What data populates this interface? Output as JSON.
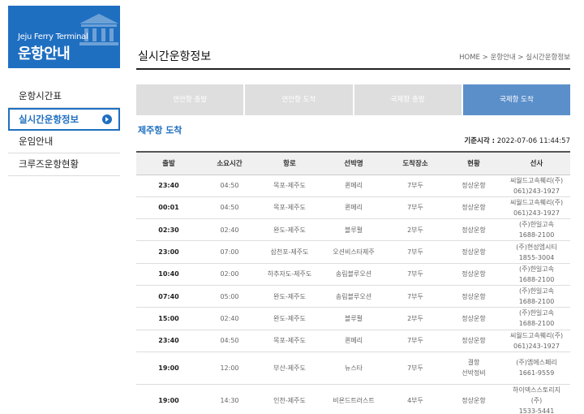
{
  "logo": {
    "en": "Jeju Ferry Terminal",
    "ko": "운항안내",
    "icon": "building-icon"
  },
  "sidebar": {
    "items": [
      {
        "label": "운항시간표"
      },
      {
        "label": "실시간운항정보"
      },
      {
        "label": "운임안내"
      },
      {
        "label": "크루즈운항현황"
      }
    ]
  },
  "header": {
    "title": "실시간운항정보",
    "breadcrumb": "HOME > 운항안내 > 실시간운항정보"
  },
  "tabs": [
    {
      "label": "연안항 출발"
    },
    {
      "label": "연안항 도착"
    },
    {
      "label": "국제항 출발"
    },
    {
      "label": "국제항 도착"
    }
  ],
  "section": {
    "title": "제주항 도착",
    "base_time_label": "기준시각 :",
    "base_time_value": "2022-07-06 11:44:57"
  },
  "table": {
    "headers": [
      "출발",
      "소요시간",
      "항로",
      "선박명",
      "도착장소",
      "현황",
      "선사"
    ],
    "rows": [
      {
        "dep": "23:40",
        "dur": "04:50",
        "route": "목포-제주도",
        "ship": "퀸메리",
        "place": "7부두",
        "status": "정상운항",
        "line1": "씨월드고속훼리(주)",
        "line2": "061)243-1927"
      },
      {
        "dep": "00:01",
        "dur": "04:50",
        "route": "목포-제주도",
        "ship": "퀸메리",
        "place": "7부두",
        "status": "정상운항",
        "line1": "씨월드고속훼리(주)",
        "line2": "061)243-1927"
      },
      {
        "dep": "02:30",
        "dur": "02:40",
        "route": "완도-제주도",
        "ship": "블루펄",
        "place": "2부두",
        "status": "정상운항",
        "line1": "(주)한일고속",
        "line2": "1688-2100"
      },
      {
        "dep": "23:00",
        "dur": "07:00",
        "route": "삼천포-제주도",
        "ship": "오션비스타제주",
        "place": "7부두",
        "status": "정상운항",
        "line1": "(주)현성엠시티",
        "line2": "1855-3004"
      },
      {
        "dep": "10:40",
        "dur": "02:00",
        "route": "하추자도-제주도",
        "ship": "송림블루오션",
        "place": "7부두",
        "status": "정상운항",
        "line1": "(주)한일고속",
        "line2": "1688-2100"
      },
      {
        "dep": "07:40",
        "dur": "05:00",
        "route": "완도-제주도",
        "ship": "송림블루오션",
        "place": "7부두",
        "status": "정상운항",
        "line1": "(주)한일고속",
        "line2": "1688-2100"
      },
      {
        "dep": "15:00",
        "dur": "02:40",
        "route": "완도-제주도",
        "ship": "블루펄",
        "place": "2부두",
        "status": "정상운항",
        "line1": "(주)한일고속",
        "line2": "1688-2100"
      },
      {
        "dep": "23:40",
        "dur": "04:50",
        "route": "목포-제주도",
        "ship": "퀸메리",
        "place": "7부두",
        "status": "정상운항",
        "line1": "씨월드고속훼리(주)",
        "line2": "061)243-1927"
      },
      {
        "dep": "19:00",
        "dur": "12:00",
        "route": "부산-제주도",
        "ship": "뉴스타",
        "place": "7부두",
        "status": "결항\n선박정비",
        "line1": "(주)엠에스페리",
        "line2": "1661-9559"
      },
      {
        "dep": "19:00",
        "dur": "14:30",
        "route": "인천-제주도",
        "ship": "비욘드트러스트",
        "place": "4부두",
        "status": "정상운항",
        "line1": "하이덱스스토리지\n(주)",
        "line2": "1533-5441"
      }
    ]
  },
  "colors": {
    "brand": "#1f6fc1",
    "tab_active": "#5b8fca",
    "tab_inactive": "#dedede"
  }
}
